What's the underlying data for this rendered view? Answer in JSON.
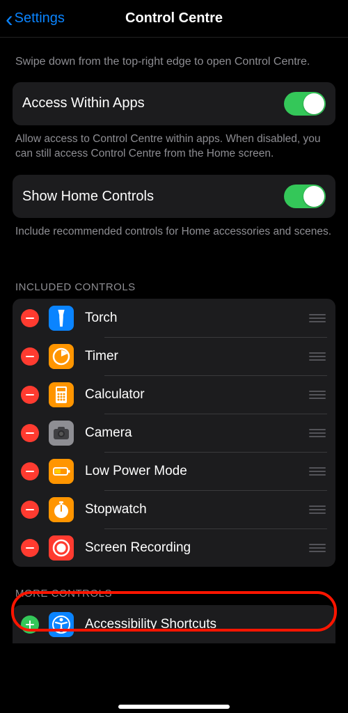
{
  "nav": {
    "back": "Settings",
    "title": "Control Centre"
  },
  "intro": "Swipe down from the top-right edge to open Control Centre.",
  "access": {
    "label": "Access Within Apps",
    "footer": "Allow access to Control Centre within apps. When disabled, you can still access Control Centre from the Home screen."
  },
  "home": {
    "label": "Show Home Controls",
    "footer": "Include recommended controls for Home accessories and scenes."
  },
  "included": {
    "header": "INCLUDED CONTROLS",
    "items": [
      {
        "label": "Torch"
      },
      {
        "label": "Timer"
      },
      {
        "label": "Calculator"
      },
      {
        "label": "Camera"
      },
      {
        "label": "Low Power Mode"
      },
      {
        "label": "Stopwatch"
      },
      {
        "label": "Screen Recording"
      }
    ]
  },
  "more": {
    "header": "MORE CONTROLS",
    "items": [
      {
        "label": "Accessibility Shortcuts"
      }
    ]
  }
}
